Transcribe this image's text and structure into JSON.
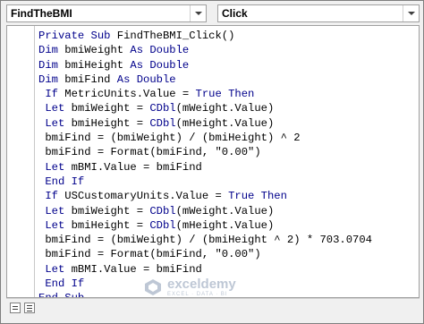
{
  "toolbar": {
    "object_combo": "FindTheBMI",
    "procedure_combo": "Click"
  },
  "code_lines": [
    [
      {
        "t": "Private Sub ",
        "k": true
      },
      {
        "t": "FindTheBMI_Click()",
        "k": false
      }
    ],
    [
      {
        "t": "Dim ",
        "k": true
      },
      {
        "t": "bmiWeight ",
        "k": false
      },
      {
        "t": "As Double",
        "k": true
      }
    ],
    [
      {
        "t": "Dim ",
        "k": true
      },
      {
        "t": "bmiHeight ",
        "k": false
      },
      {
        "t": "As Double",
        "k": true
      }
    ],
    [
      {
        "t": "Dim ",
        "k": true
      },
      {
        "t": "bmiFind ",
        "k": false
      },
      {
        "t": "As Double",
        "k": true
      }
    ],
    [
      {
        "t": " If ",
        "k": true
      },
      {
        "t": "MetricUnits.Value = ",
        "k": false
      },
      {
        "t": "True Then",
        "k": true
      }
    ],
    [
      {
        "t": " Let ",
        "k": true
      },
      {
        "t": "bmiWeight = ",
        "k": false
      },
      {
        "t": "CDbl",
        "k": true
      },
      {
        "t": "(mWeight.Value)",
        "k": false
      }
    ],
    [
      {
        "t": " Let ",
        "k": true
      },
      {
        "t": "bmiHeight = ",
        "k": false
      },
      {
        "t": "CDbl",
        "k": true
      },
      {
        "t": "(mHeight.Value)",
        "k": false
      }
    ],
    [
      {
        "t": " bmiFind = (bmiWeight) / (bmiHeight) ^ 2",
        "k": false
      }
    ],
    [
      {
        "t": " bmiFind = Format(bmiFind, \"0.00\")",
        "k": false
      }
    ],
    [
      {
        "t": " Let ",
        "k": true
      },
      {
        "t": "mBMI.Value = bmiFind",
        "k": false
      }
    ],
    [
      {
        "t": " End If",
        "k": true
      }
    ],
    [
      {
        "t": " If ",
        "k": true
      },
      {
        "t": "USCustomaryUnits.Value = ",
        "k": false
      },
      {
        "t": "True Then",
        "k": true
      }
    ],
    [
      {
        "t": " Let ",
        "k": true
      },
      {
        "t": "bmiWeight = ",
        "k": false
      },
      {
        "t": "CDbl",
        "k": true
      },
      {
        "t": "(mWeight.Value)",
        "k": false
      }
    ],
    [
      {
        "t": " Let ",
        "k": true
      },
      {
        "t": "bmiHeight = ",
        "k": false
      },
      {
        "t": "CDbl",
        "k": true
      },
      {
        "t": "(mHeight.Value)",
        "k": false
      }
    ],
    [
      {
        "t": " bmiFind = (bmiWeight) / (bmiHeight ^ 2) * 703.0704",
        "k": false
      }
    ],
    [
      {
        "t": " bmiFind = Format(bmiFind, \"0.00\")",
        "k": false
      }
    ],
    [
      {
        "t": " Let ",
        "k": true
      },
      {
        "t": "mBMI.Value = bmiFind",
        "k": false
      }
    ],
    [
      {
        "t": " End If",
        "k": true
      }
    ],
    [
      {
        "t": "End Sub",
        "k": true
      }
    ]
  ],
  "watermark": {
    "name": "exceldemy",
    "tagline": "EXCEL · DATA · BI"
  },
  "colors": {
    "keyword": "#00008b",
    "text": "#000000"
  }
}
